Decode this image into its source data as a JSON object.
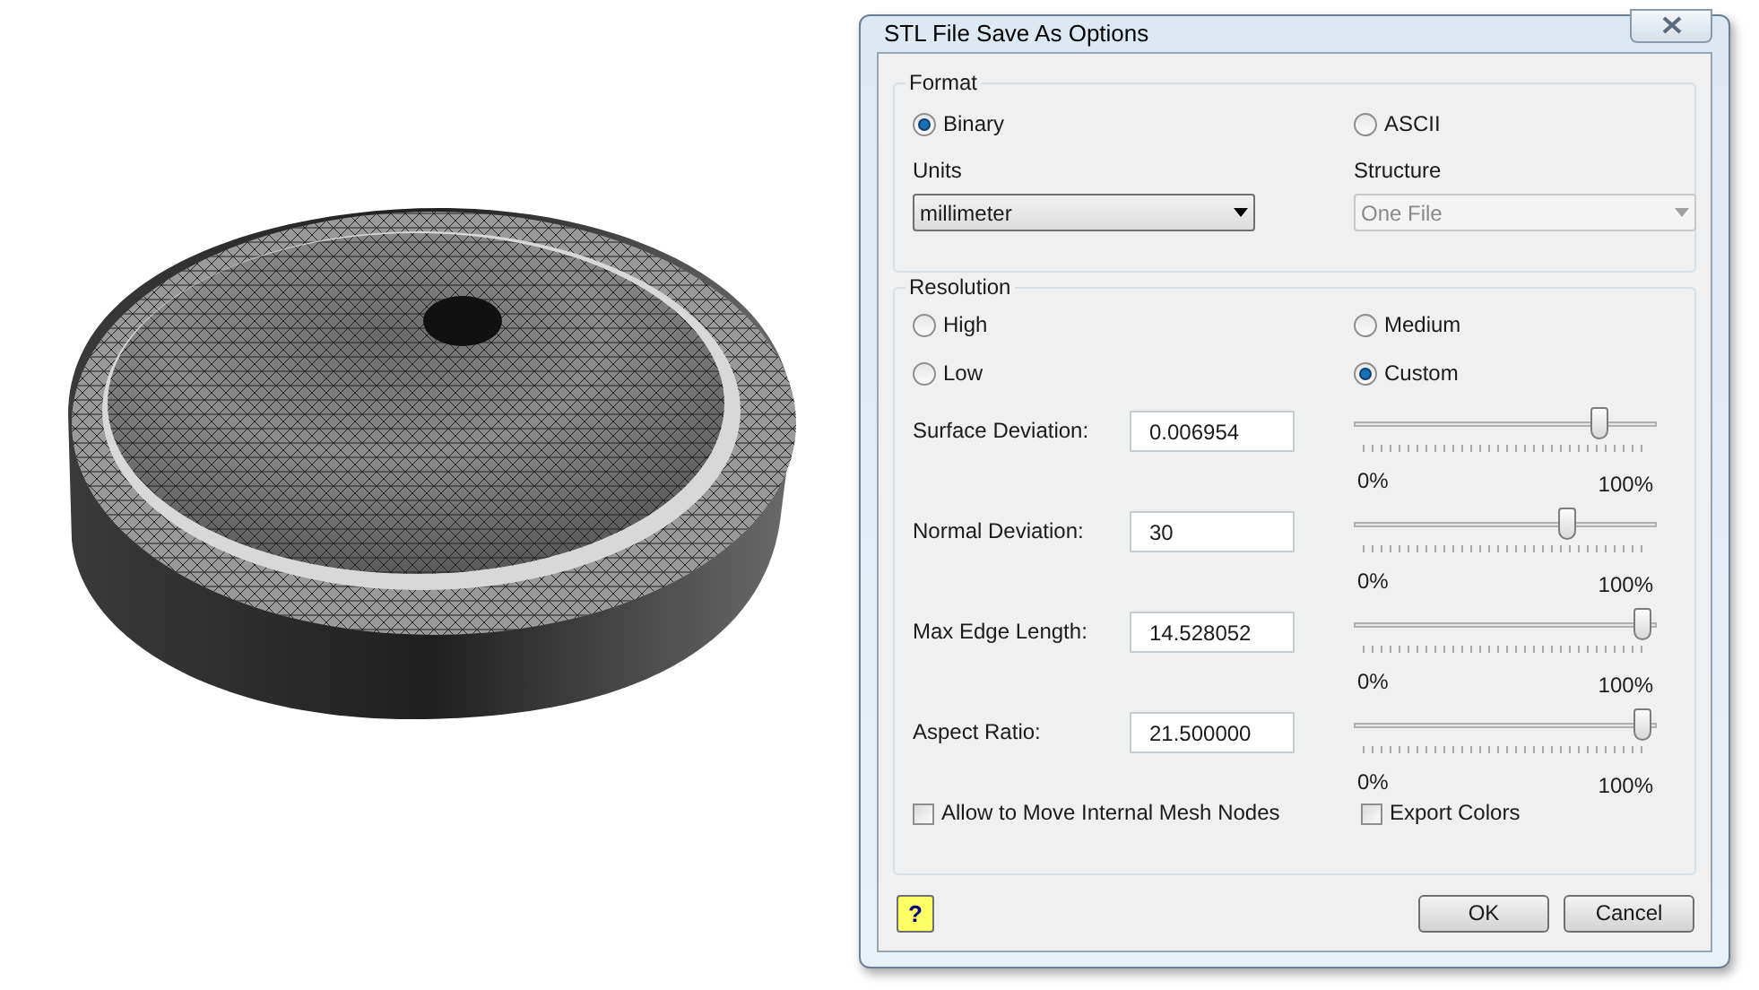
{
  "window": {
    "title": "STL File Save As Options"
  },
  "format": {
    "title": "Format",
    "options": [
      {
        "label": "Binary",
        "selected": true
      },
      {
        "label": "ASCII",
        "selected": false
      }
    ],
    "units": {
      "label": "Units",
      "value": "millimeter",
      "disabled": false
    },
    "structure": {
      "label": "Structure",
      "value": "One File",
      "disabled": true
    }
  },
  "resolution": {
    "title": "Resolution",
    "presets": [
      {
        "label": "High",
        "selected": false
      },
      {
        "label": "Medium",
        "selected": false
      },
      {
        "label": "Low",
        "selected": false
      },
      {
        "label": "Custom",
        "selected": true
      }
    ],
    "parameters": [
      {
        "label": "Surface Deviation:",
        "value": "0.006954",
        "level": 0.83,
        "min_label": "0%",
        "max_label": "100%"
      },
      {
        "label": "Normal Deviation:",
        "value": "30",
        "level": 0.72,
        "min_label": "0%",
        "max_label": "100%"
      },
      {
        "label": "Max Edge Length:",
        "value": "14.528052",
        "level": 0.98,
        "min_label": "0%",
        "max_label": "100%"
      },
      {
        "label": "Aspect Ratio:",
        "value": "21.500000",
        "level": 0.98,
        "min_label": "0%",
        "max_label": "100%"
      }
    ],
    "checkboxes": [
      {
        "label": "Allow to Move Internal Mesh Nodes",
        "checked": false
      },
      {
        "label": "Export Colors",
        "checked": false
      }
    ]
  },
  "help_button": {
    "label": "?"
  },
  "buttons": [
    {
      "label": "OK"
    },
    {
      "label": "Cancel"
    }
  ]
}
